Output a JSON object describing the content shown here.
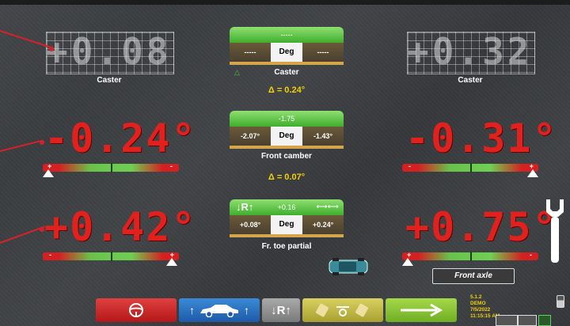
{
  "left_caster": {
    "ghost_value": "+0.08",
    "label": "Caster"
  },
  "right_caster": {
    "ghost_value": "+0.32",
    "label": "Caster"
  },
  "center_caster": {
    "top_value": "-----",
    "left_value": "-----",
    "unit": "Deg",
    "right_value": "-----",
    "label": "Caster",
    "delta_label": "Δ = 0.24°"
  },
  "left_camber": {
    "value": "-0.24°"
  },
  "right_camber": {
    "value": "-0.31°"
  },
  "center_camber": {
    "top_value": "-1.75",
    "left_value": "-2.07°",
    "unit": "Deg",
    "right_value": "-1.43°",
    "label": "Front camber",
    "delta_label": "Δ = 0.07°"
  },
  "left_toe": {
    "value": "+0.42°"
  },
  "right_toe": {
    "value": "+0.75°"
  },
  "center_toe": {
    "top_value": "+0.16",
    "left_value": "+0.08°",
    "unit": "Deg",
    "right_value": "+0.24°",
    "label": "Fr. toe partial",
    "badge": "R"
  },
  "axle_label": "Front axle",
  "bar_signs": {
    "minus": "-",
    "plus": "+"
  },
  "bottom_toolbar": {
    "toe_badge": "R"
  },
  "version_info": {
    "version": "5.1.2",
    "mode": "DEMO",
    "date": "7/5/2022",
    "time": "11:15:15 AM"
  },
  "colors": {
    "accent_red": "#e0211d",
    "bar_green": "#69c24b",
    "delta_yellow": "#f4d000"
  }
}
